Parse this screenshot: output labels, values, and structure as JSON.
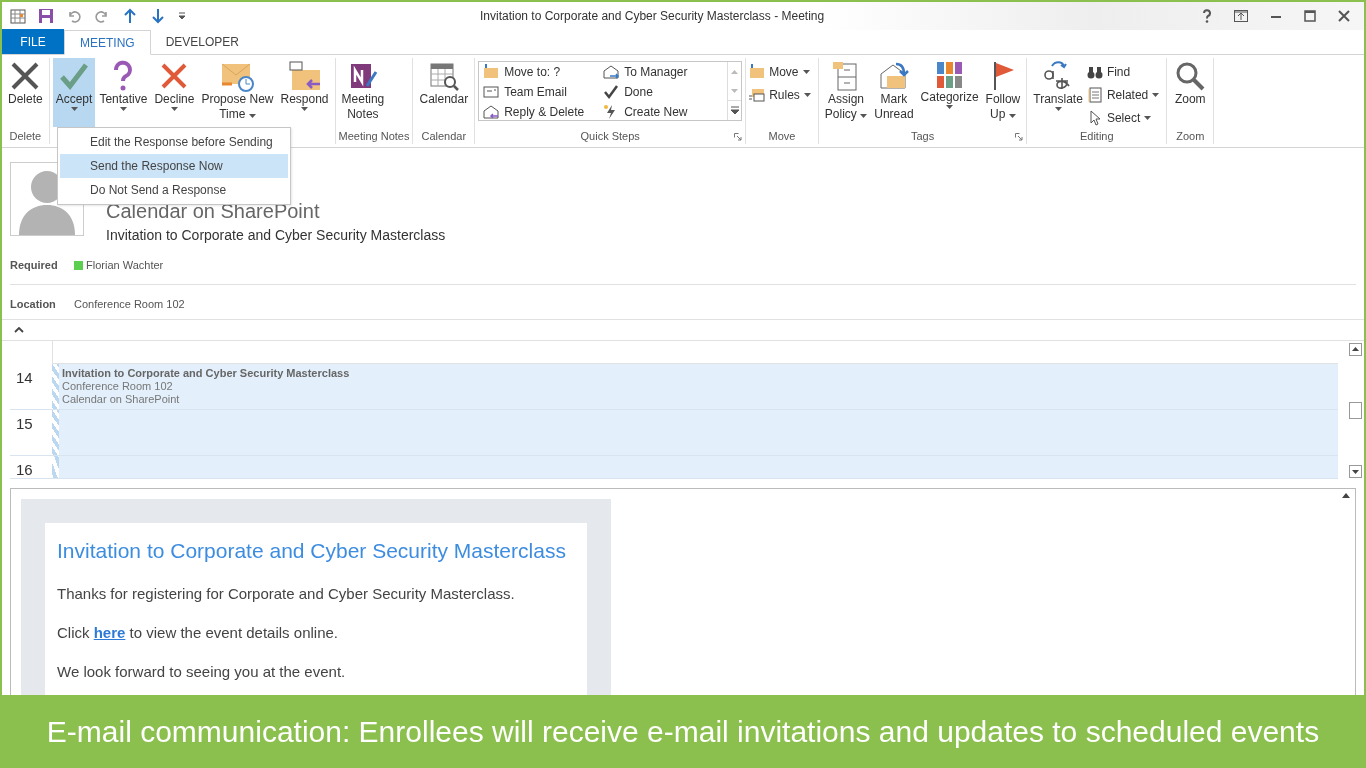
{
  "window": {
    "title": "Invitation to Corporate and Cyber Security Masterclass - Meeting"
  },
  "tabs": [
    {
      "label": "FILE",
      "kind": "file",
      "selected": false
    },
    {
      "label": "MEETING",
      "kind": "tab",
      "selected": true
    },
    {
      "label": "DEVELOPER",
      "kind": "tab",
      "selected": false
    }
  ],
  "ribbon": {
    "groups": [
      {
        "label": "Delete",
        "launcher": false,
        "items": [
          {
            "kind": "large",
            "lines": [
              "Delete"
            ],
            "dropdown": false,
            "pressed": false
          }
        ]
      },
      {
        "launcher": false,
        "items": [
          {
            "kind": "large",
            "lines": [
              "Accept"
            ],
            "dropdown": true,
            "pressed": true
          },
          {
            "kind": "large",
            "lines": [
              "Tentative"
            ],
            "dropdown": true,
            "pressed": false
          },
          {
            "kind": "large",
            "lines": [
              "Decline"
            ],
            "dropdown": true,
            "pressed": false
          },
          {
            "kind": "large",
            "lines": [
              "Propose New",
              "Time"
            ],
            "dropdown": true,
            "pressed": false
          },
          {
            "kind": "large",
            "lines": [
              "Respond"
            ],
            "dropdown": true,
            "pressed": false
          }
        ]
      },
      {
        "label": "Meeting Notes",
        "launcher": false,
        "items": [
          {
            "kind": "large",
            "lines": [
              "Meeting",
              "Notes"
            ],
            "dropdown": false,
            "pressed": false
          }
        ]
      },
      {
        "label": "Calendar",
        "launcher": false,
        "items": [
          {
            "kind": "large",
            "lines": [
              "Calendar"
            ],
            "dropdown": false,
            "pressed": false
          }
        ]
      },
      {
        "label": "Quick Steps",
        "launcher": true,
        "items": [
          {
            "kind": "gallery",
            "entries": [
              "Move to: ?",
              "Team Email",
              "Reply & Delete",
              "To Manager",
              "Done",
              "Create New"
            ]
          }
        ]
      },
      {
        "label": "Move",
        "launcher": false,
        "items": [
          {
            "kind": "small",
            "entries": [
              {
                "label": "Move",
                "dropdown": true
              },
              {
                "label": "Rules",
                "dropdown": true
              }
            ]
          }
        ]
      },
      {
        "label": "Tags",
        "launcher": true,
        "items": [
          {
            "kind": "large",
            "lines": [
              "Assign",
              "Policy"
            ],
            "dropdown": true,
            "pressed": false
          },
          {
            "kind": "large",
            "lines": [
              "Mark",
              "Unread"
            ],
            "dropdown": false,
            "pressed": false
          },
          {
            "kind": "large",
            "lines": [
              "Categorize"
            ],
            "dropdown": true,
            "pressed": false
          },
          {
            "kind": "large",
            "lines": [
              "Follow",
              "Up"
            ],
            "dropdown": true,
            "pressed": false
          }
        ]
      },
      {
        "label": "Editing",
        "launcher": false,
        "items": [
          {
            "kind": "large",
            "lines": [
              "Translate"
            ],
            "dropdown": true,
            "pressed": false
          },
          {
            "kind": "small",
            "entries": [
              {
                "label": "Find",
                "dropdown": false
              },
              {
                "label": "Related",
                "dropdown": true
              },
              {
                "label": "Select",
                "dropdown": true
              }
            ]
          }
        ]
      },
      {
        "label": "Zoom",
        "launcher": false,
        "items": [
          {
            "kind": "large",
            "lines": [
              "Zoom"
            ],
            "dropdown": false,
            "pressed": false
          }
        ]
      }
    ]
  },
  "menu": {
    "items": [
      {
        "label": "Edit the Response before Sending",
        "selected": false
      },
      {
        "label": "Send the Response Now",
        "selected": true
      },
      {
        "label": "Do Not Send a Response",
        "selected": false
      }
    ]
  },
  "header": {
    "organizer": "Calendar on SharePoint",
    "subject": "Invitation to Corporate and Cyber Security Masterclass",
    "required_label": "Required",
    "attendees": [
      {
        "name": "Florian Wachter",
        "color": "#5ccf50"
      }
    ],
    "location_label": "Location",
    "location": "Conference Room 102"
  },
  "calendar": {
    "hours": [
      "14",
      "15",
      "16"
    ],
    "event": {
      "title": "Invitation to Corporate and Cyber Security Masterclass",
      "location": "Conference Room 102",
      "organizer": "Calendar on SharePoint"
    }
  },
  "body": {
    "heading": "Invitation to Corporate and Cyber Security Masterclass",
    "paragraphs": [
      [
        {
          "kind": "text",
          "text": "Thanks for registering for Corporate and Cyber Security Masterclass."
        }
      ],
      [
        {
          "kind": "text",
          "text": "Click "
        },
        {
          "kind": "link",
          "text": "here"
        },
        {
          "kind": "text",
          "text": " to view the event details online."
        }
      ],
      [
        {
          "kind": "text",
          "text": "We look forward to seeing you at the event."
        }
      ]
    ]
  },
  "caption": "E-mail communication: Enrollees will receive e-mail invitations and updates to scheduled events"
}
